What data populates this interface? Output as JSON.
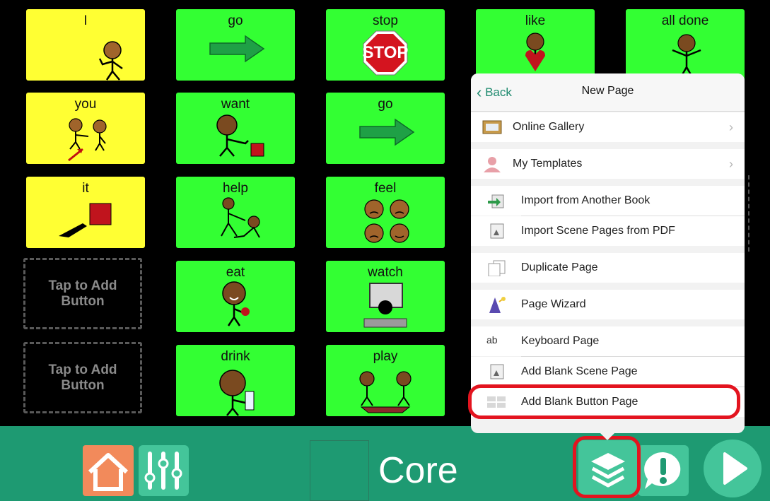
{
  "grid": {
    "cells": [
      {
        "label": "I",
        "icon": "person-pointing-self-icon"
      },
      {
        "label": "you",
        "icon": "two-people-pointing-icon"
      },
      {
        "label": "it",
        "icon": "point-to-square-icon"
      },
      {
        "label": "Tap to Add Button",
        "icon": "empty-slot"
      },
      {
        "label": "Tap to Add Button",
        "icon": "empty-slot"
      },
      {
        "label": "go",
        "icon": "green-arrow-icon"
      },
      {
        "label": "want",
        "icon": "person-reaching-icon"
      },
      {
        "label": "help",
        "icon": "helping-people-icon"
      },
      {
        "label": "eat",
        "icon": "person-eating-icon"
      },
      {
        "label": "drink",
        "icon": "person-drinking-icon"
      },
      {
        "label": "stop",
        "icon": "stop-sign-icon"
      },
      {
        "label": "go",
        "icon": "green-arrow-icon"
      },
      {
        "label": "feel",
        "icon": "four-faces-icon"
      },
      {
        "label": "watch",
        "icon": "person-watching-tv-icon"
      },
      {
        "label": "play",
        "icon": "two-people-playing-icon"
      },
      {
        "label": "like",
        "icon": "person-holding-heart-icon"
      },
      {
        "label": "all done",
        "icon": "person-hands-up-icon"
      }
    ],
    "stop_sign_text": "STOP",
    "colors": {
      "pronoun": "#ffff33",
      "verb": "#33ff33"
    }
  },
  "popover": {
    "back_label": "Back",
    "title": "New Page",
    "items": [
      {
        "label": "Online Gallery",
        "icon": "gallery-frame-icon",
        "chevron": true
      },
      {
        "label": "My Templates",
        "icon": "person-silhouette-icon",
        "chevron": true
      },
      {
        "label": "Import from Another Book",
        "icon": "import-book-icon"
      },
      {
        "label": "Import Scene Pages from PDF",
        "icon": "scene-pdf-icon"
      },
      {
        "label": "Duplicate Page",
        "icon": "duplicate-pages-icon"
      },
      {
        "label": "Page Wizard",
        "icon": "wizard-icon"
      },
      {
        "label": "Keyboard Page",
        "icon": "keyboard-ab-icon",
        "icon_text": "ab"
      },
      {
        "label": "Add Blank Scene Page",
        "icon": "blank-scene-icon"
      },
      {
        "label": "Add Blank Button Page",
        "icon": "blank-button-grid-icon"
      }
    ],
    "chevron_glyph": "›"
  },
  "toolbar": {
    "title": "Core",
    "accent": "#1e9a72",
    "highlight_color": "#e3141f"
  }
}
